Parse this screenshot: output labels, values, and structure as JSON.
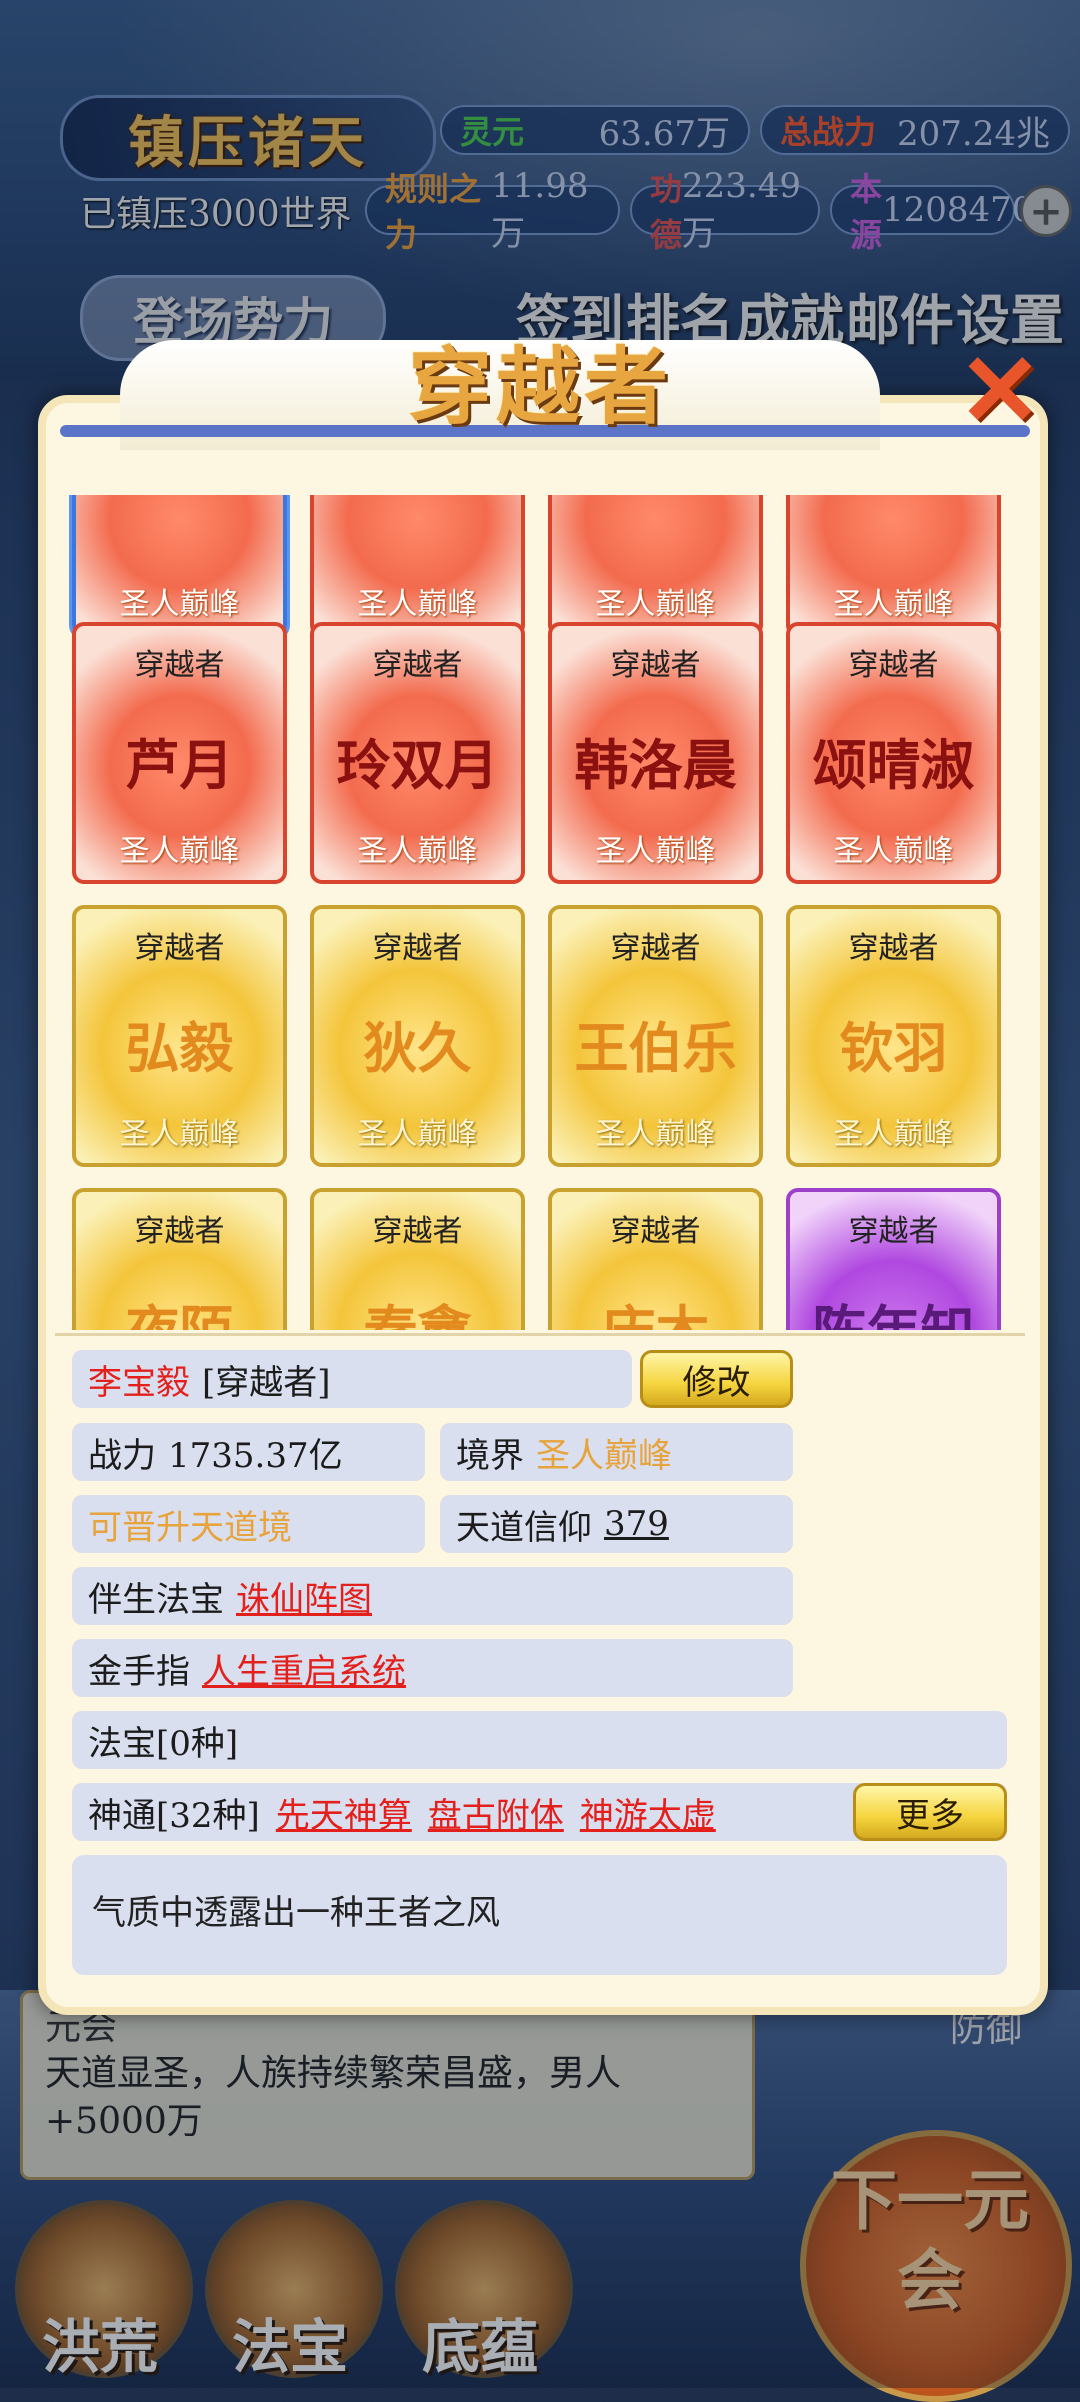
{
  "hud": {
    "title": "镇压诸天",
    "lingyuan_label": "灵元",
    "lingyuan_value": "63.67万",
    "power_label": "总战力",
    "power_value": "207.24兆",
    "suppressed": "已镇压3000世界",
    "rule_label": "规则之力",
    "rule_value": "11.98万",
    "merit_label": "功德",
    "merit_value": "223.49万",
    "origin_label": "本源",
    "origin_value": "1208470",
    "plus": "+",
    "deploy_button": "登场势力",
    "menu": [
      "签到",
      "排名",
      "成就",
      "邮件",
      "设置"
    ]
  },
  "modal": {
    "title": "穿越者",
    "close": "✕",
    "cards": [
      {
        "type": "",
        "name": "",
        "realm": "圣人巅峰",
        "style": "red",
        "selected": true
      },
      {
        "type": "",
        "name": "",
        "realm": "圣人巅峰",
        "style": "red"
      },
      {
        "type": "",
        "name": "",
        "realm": "圣人巅峰",
        "style": "red"
      },
      {
        "type": "",
        "name": "",
        "realm": "圣人巅峰",
        "style": "red"
      },
      {
        "type": "穿越者",
        "name": "芦月",
        "realm": "圣人巅峰",
        "style": "red"
      },
      {
        "type": "穿越者",
        "name": "玲双月",
        "realm": "圣人巅峰",
        "style": "red"
      },
      {
        "type": "穿越者",
        "name": "韩洛晨",
        "realm": "圣人巅峰",
        "style": "red"
      },
      {
        "type": "穿越者",
        "name": "颂晴淑",
        "realm": "圣人巅峰",
        "style": "red"
      },
      {
        "type": "穿越者",
        "name": "弘毅",
        "realm": "圣人巅峰",
        "style": "gold"
      },
      {
        "type": "穿越者",
        "name": "狄久",
        "realm": "圣人巅峰",
        "style": "gold"
      },
      {
        "type": "穿越者",
        "name": "王伯乐",
        "realm": "圣人巅峰",
        "style": "gold"
      },
      {
        "type": "穿越者",
        "name": "钦羽",
        "realm": "圣人巅峰",
        "style": "gold"
      },
      {
        "type": "穿越者",
        "name": "夜陌",
        "realm": "",
        "style": "gold"
      },
      {
        "type": "穿越者",
        "name": "秦盦",
        "realm": "",
        "style": "gold"
      },
      {
        "type": "穿越者",
        "name": "庆木",
        "realm": "",
        "style": "gold"
      },
      {
        "type": "穿越者",
        "name": "陈年知",
        "realm": "",
        "style": "purple"
      }
    ],
    "detail": {
      "name": "李宝毅",
      "role": "[穿越者]",
      "edit_button": "修改",
      "power_label": "战力",
      "power_value": "1735.37亿",
      "realm_label": "境界",
      "realm_value": "圣人巅峰",
      "upgrade": "可晋升天道境",
      "faith_label": "天道信仰",
      "faith_value": "379",
      "treasure_label": "伴生法宝",
      "treasure_value": "诛仙阵图",
      "finger_label": "金手指",
      "finger_value": "人生重启系统",
      "fabao": "法宝[0种]",
      "shentong_label": "神通[32种]",
      "shentong": [
        "先天神算",
        "盘古附体",
        "神游太虚"
      ],
      "more_button": "更多",
      "description": "气质中透露出一种王者之风"
    }
  },
  "background": {
    "event_title": "元会",
    "event_text": "天道显圣，人族持续繁荣昌盛，男人+5000万",
    "defense": "防御",
    "nav": [
      "洪荒",
      "法宝",
      "底蕴"
    ],
    "next": "下一元会"
  }
}
